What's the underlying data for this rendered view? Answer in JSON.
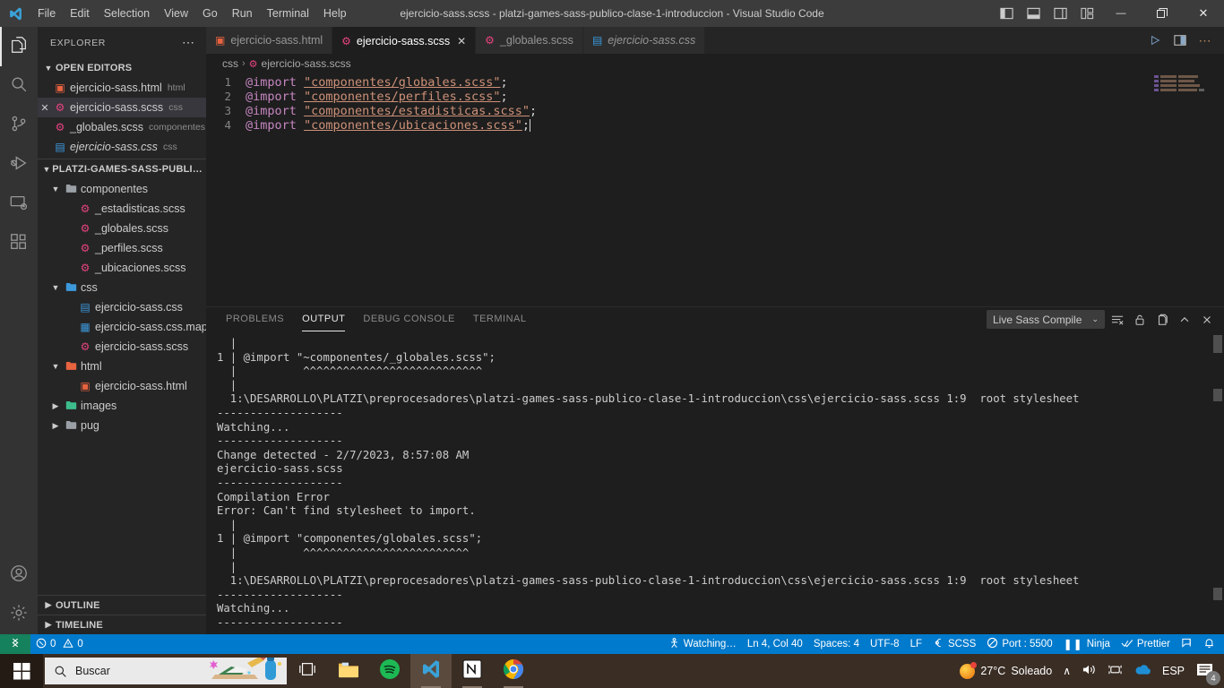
{
  "titlebar": {
    "logo_icon": "vscode-logo-icon",
    "title": "ejercicio-sass.scss - platzi-games-sass-publico-clase-1-introduccion - Visual Studio Code",
    "menus": [
      "File",
      "Edit",
      "Selection",
      "View",
      "Go",
      "Run",
      "Terminal",
      "Help"
    ],
    "layout_icons": [
      "toggle-primary-sidebar-icon",
      "toggle-panel-icon",
      "toggle-secondary-sidebar-icon",
      "customize-layout-icon"
    ],
    "window_controls": {
      "minimize": "—",
      "restore": "❐",
      "close": "✕"
    }
  },
  "activitybar": {
    "items": [
      {
        "name": "explorer",
        "icon": "files-icon",
        "active": true
      },
      {
        "name": "search",
        "icon": "search-icon",
        "active": false
      },
      {
        "name": "source-control",
        "icon": "source-control-icon",
        "active": false
      },
      {
        "name": "run-and-debug",
        "icon": "run-debug-icon",
        "active": false
      },
      {
        "name": "remote-explorer",
        "icon": "remote-explorer-icon",
        "active": false
      },
      {
        "name": "extensions",
        "icon": "extensions-icon",
        "active": false
      }
    ],
    "bottom": [
      {
        "name": "accounts",
        "icon": "account-icon"
      },
      {
        "name": "manage",
        "icon": "gear-icon"
      }
    ]
  },
  "sidebar": {
    "title": "EXPLORER",
    "more_actions": "⋯",
    "open_editors": {
      "label": "OPEN EDITORS",
      "expanded": true,
      "items": [
        {
          "name": "ejercicio-sass.html",
          "desc": "html",
          "icon": "html-file-icon",
          "selected": false,
          "dirty": false,
          "italic": false
        },
        {
          "name": "ejercicio-sass.scss",
          "desc": "css",
          "icon": "sass-file-icon",
          "selected": true,
          "dirty": false,
          "italic": false
        },
        {
          "name": "_globales.scss",
          "desc": "componentes",
          "icon": "sass-file-icon",
          "selected": false,
          "dirty": false,
          "italic": false
        },
        {
          "name": "ejercicio-sass.css",
          "desc": "css",
          "icon": "css-file-icon",
          "selected": false,
          "dirty": false,
          "italic": true
        }
      ]
    },
    "project": {
      "label": "PLATZI-GAMES-SASS-PUBLICO-CLASE...",
      "expanded": true,
      "tree": [
        {
          "name": "componentes",
          "type": "folder",
          "icon": "folder-open-icon",
          "indent": 1,
          "expanded": true
        },
        {
          "name": "_estadisticas.scss",
          "type": "file",
          "icon": "sass-file-icon",
          "indent": 2
        },
        {
          "name": "_globales.scss",
          "type": "file",
          "icon": "sass-file-icon",
          "indent": 2
        },
        {
          "name": "_perfiles.scss",
          "type": "file",
          "icon": "sass-file-icon",
          "indent": 2
        },
        {
          "name": "_ubicaciones.scss",
          "type": "file",
          "icon": "sass-file-icon",
          "indent": 2
        },
        {
          "name": "css",
          "type": "folder",
          "icon": "folder-css-icon",
          "indent": 1,
          "expanded": true
        },
        {
          "name": "ejercicio-sass.css",
          "type": "file",
          "icon": "css-file-icon",
          "indent": 2
        },
        {
          "name": "ejercicio-sass.css.map",
          "type": "file",
          "icon": "map-file-icon",
          "indent": 2
        },
        {
          "name": "ejercicio-sass.scss",
          "type": "file",
          "icon": "sass-file-icon",
          "indent": 2
        },
        {
          "name": "html",
          "type": "folder",
          "icon": "folder-html-icon",
          "indent": 1,
          "expanded": true
        },
        {
          "name": "ejercicio-sass.html",
          "type": "file",
          "icon": "html-file-icon",
          "indent": 2
        },
        {
          "name": "images",
          "type": "folder",
          "icon": "folder-images-icon",
          "indent": 1,
          "expanded": false
        },
        {
          "name": "pug",
          "type": "folder",
          "icon": "folder-icon",
          "indent": 1,
          "expanded": false
        }
      ]
    },
    "bottom_sections": [
      {
        "label": "OUTLINE",
        "expanded": false
      },
      {
        "label": "TIMELINE",
        "expanded": false
      }
    ]
  },
  "editor": {
    "tabs": [
      {
        "label": "ejercicio-sass.html",
        "icon": "html-file-icon",
        "active": false,
        "preview": false,
        "close": false
      },
      {
        "label": "ejercicio-sass.scss",
        "icon": "sass-file-icon",
        "active": true,
        "preview": false,
        "close": true,
        "close_glyph": "✕"
      },
      {
        "label": "_globales.scss",
        "icon": "sass-file-icon",
        "active": false,
        "preview": false,
        "close": false
      },
      {
        "label": "ejercicio-sass.css",
        "icon": "css-file-icon",
        "active": false,
        "preview": true,
        "close": false
      }
    ],
    "actions": [
      "run-icon",
      "split-editor-icon",
      "more-actions-icon"
    ],
    "breadcrumbs": {
      "folder": "css",
      "separator": "›",
      "file": "ejercicio-sass.scss",
      "file_icon": "sass-file-icon"
    },
    "lines": [
      {
        "num": "1",
        "at": "@import",
        "string": "\"componentes/globales.scss\"",
        "end": ";"
      },
      {
        "num": "2",
        "at": "@import",
        "string": "\"componentes/perfiles.scss\"",
        "end": ";"
      },
      {
        "num": "3",
        "at": "@import",
        "string": "\"componentes/estadisticas.scss\"",
        "end": ";"
      },
      {
        "num": "4",
        "at": "@import",
        "string": "\"componentes/ubicaciones.scss\"",
        "end": ";"
      }
    ]
  },
  "panel": {
    "tabs": [
      {
        "label": "PROBLEMS",
        "active": false
      },
      {
        "label": "OUTPUT",
        "active": true
      },
      {
        "label": "DEBUG CONSOLE",
        "active": false
      },
      {
        "label": "TERMINAL",
        "active": false
      }
    ],
    "channel": "Live Sass Compile",
    "channel_caret": "⌄",
    "actions": [
      "clear-output-icon",
      "lock-scroll-icon",
      "open-in-editor-icon",
      "collapse-panel-icon",
      "close-panel-icon"
    ],
    "output_lines": [
      "  |",
      "1 | @import \"~componentes/_globales.scss\";",
      "  |          ^^^^^^^^^^^^^^^^^^^^^^^^^^^",
      "  |",
      "  1:\\DESARROLLO\\PLATZI\\preprocesadores\\platzi-games-sass-publico-clase-1-introduccion\\css\\ejercicio-sass.scss 1:9  root stylesheet",
      "-------------------",
      "Watching...",
      "-------------------",
      "Change detected - 2/7/2023, 8:57:08 AM",
      "ejercicio-sass.scss",
      "-------------------",
      "Compilation Error",
      "Error: Can't find stylesheet to import.",
      "  |",
      "1 | @import \"componentes/globales.scss\";",
      "  |          ^^^^^^^^^^^^^^^^^^^^^^^^^",
      "  |",
      "  1:\\DESARROLLO\\PLATZI\\preprocesadores\\platzi-games-sass-publico-clase-1-introduccion\\css\\ejercicio-sass.scss 1:9  root stylesheet",
      "-------------------",
      "Watching...",
      "-------------------"
    ]
  },
  "statusbar": {
    "background": "#007acc",
    "remote_icon": "remote-window-icon",
    "errors": "0",
    "warnings": "0",
    "error_icon": "error-icon",
    "warning_icon": "warning-icon",
    "right_items": [
      {
        "icon": "watching-icon",
        "label": "Watching…"
      },
      {
        "icon": "",
        "label": "Ln 4, Col 40"
      },
      {
        "icon": "",
        "label": "Spaces: 4"
      },
      {
        "icon": "",
        "label": "UTF-8"
      },
      {
        "icon": "",
        "label": "LF"
      },
      {
        "icon": "sass-icon",
        "label": "SCSS"
      },
      {
        "icon": "port-icon",
        "label": "Port : 5500"
      },
      {
        "icon": "pause-icon",
        "label": "Ninja"
      },
      {
        "icon": "check-icon",
        "label": "Prettier"
      },
      {
        "icon": "feedback-icon",
        "label": ""
      },
      {
        "icon": "bell-icon",
        "label": ""
      }
    ]
  },
  "taskbar": {
    "start_icon": "windows-start-icon",
    "search_placeholder": "Buscar",
    "search_icon": "search-icon",
    "apps": [
      {
        "name": "task-view",
        "icon": "task-view-icon",
        "active": false,
        "open": false
      },
      {
        "name": "file-explorer",
        "icon": "file-explorer-icon",
        "active": false,
        "open": false
      },
      {
        "name": "spotify",
        "icon": "spotify-icon",
        "active": false,
        "open": false
      },
      {
        "name": "visual-studio-code",
        "icon": "vscode-icon",
        "active": true,
        "open": true
      },
      {
        "name": "notion",
        "icon": "notion-icon",
        "active": false,
        "open": true
      },
      {
        "name": "google-chrome",
        "icon": "chrome-icon",
        "active": false,
        "open": true
      }
    ],
    "tray": {
      "weather_temp": "27°C",
      "weather_desc": "Soleado",
      "weather_icon": "sun-icon",
      "chevron": "∧",
      "volume_icon": "volume-icon",
      "camera_icon": "camera-icon",
      "onedrive_icon": "onedrive-icon",
      "language": "ESP",
      "notifications_icon": "notifications-icon",
      "notifications_count": "4"
    }
  }
}
